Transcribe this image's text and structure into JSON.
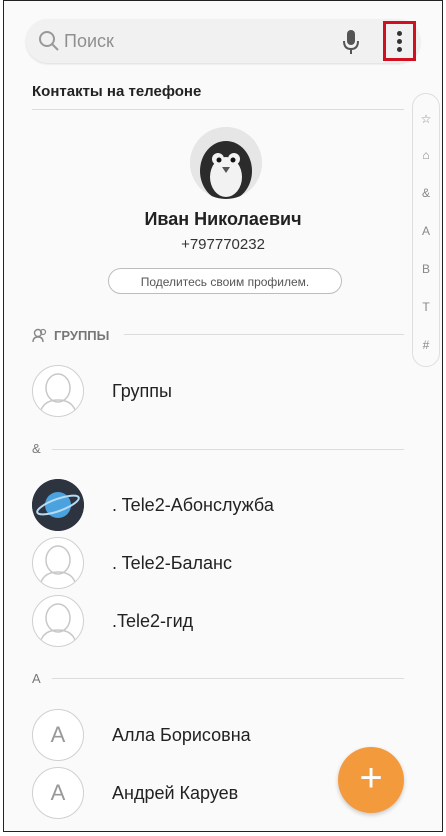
{
  "search": {
    "placeholder": "Поиск",
    "icon": "search-icon",
    "mic_icon": "mic-icon",
    "menu_icon": "more-vertical-icon"
  },
  "section_title": "Контакты на телефоне",
  "index_letters": [
    "☆",
    "⌂",
    "&",
    "A",
    "B",
    "T",
    "#"
  ],
  "profile": {
    "name": "Иван Николаевич",
    "phone": "+797770232",
    "share_label": "Поделитесь своим профилем."
  },
  "groups_header": "ГРУППЫ",
  "groups_item": "Группы",
  "letters": {
    "amp": "&",
    "a": "A"
  },
  "contacts_amp": [
    ". Tele2-Абонслужба",
    ". Tele2-Баланс",
    ".Tele2-гид"
  ],
  "contacts_a": [
    {
      "name": "Алла Борисовна",
      "initial": "A"
    },
    {
      "name": "Андрей Каруев",
      "initial": "A"
    }
  ],
  "fab_label": "+",
  "colors": {
    "accent": "#f39a3d",
    "highlight": "#d0101e"
  }
}
